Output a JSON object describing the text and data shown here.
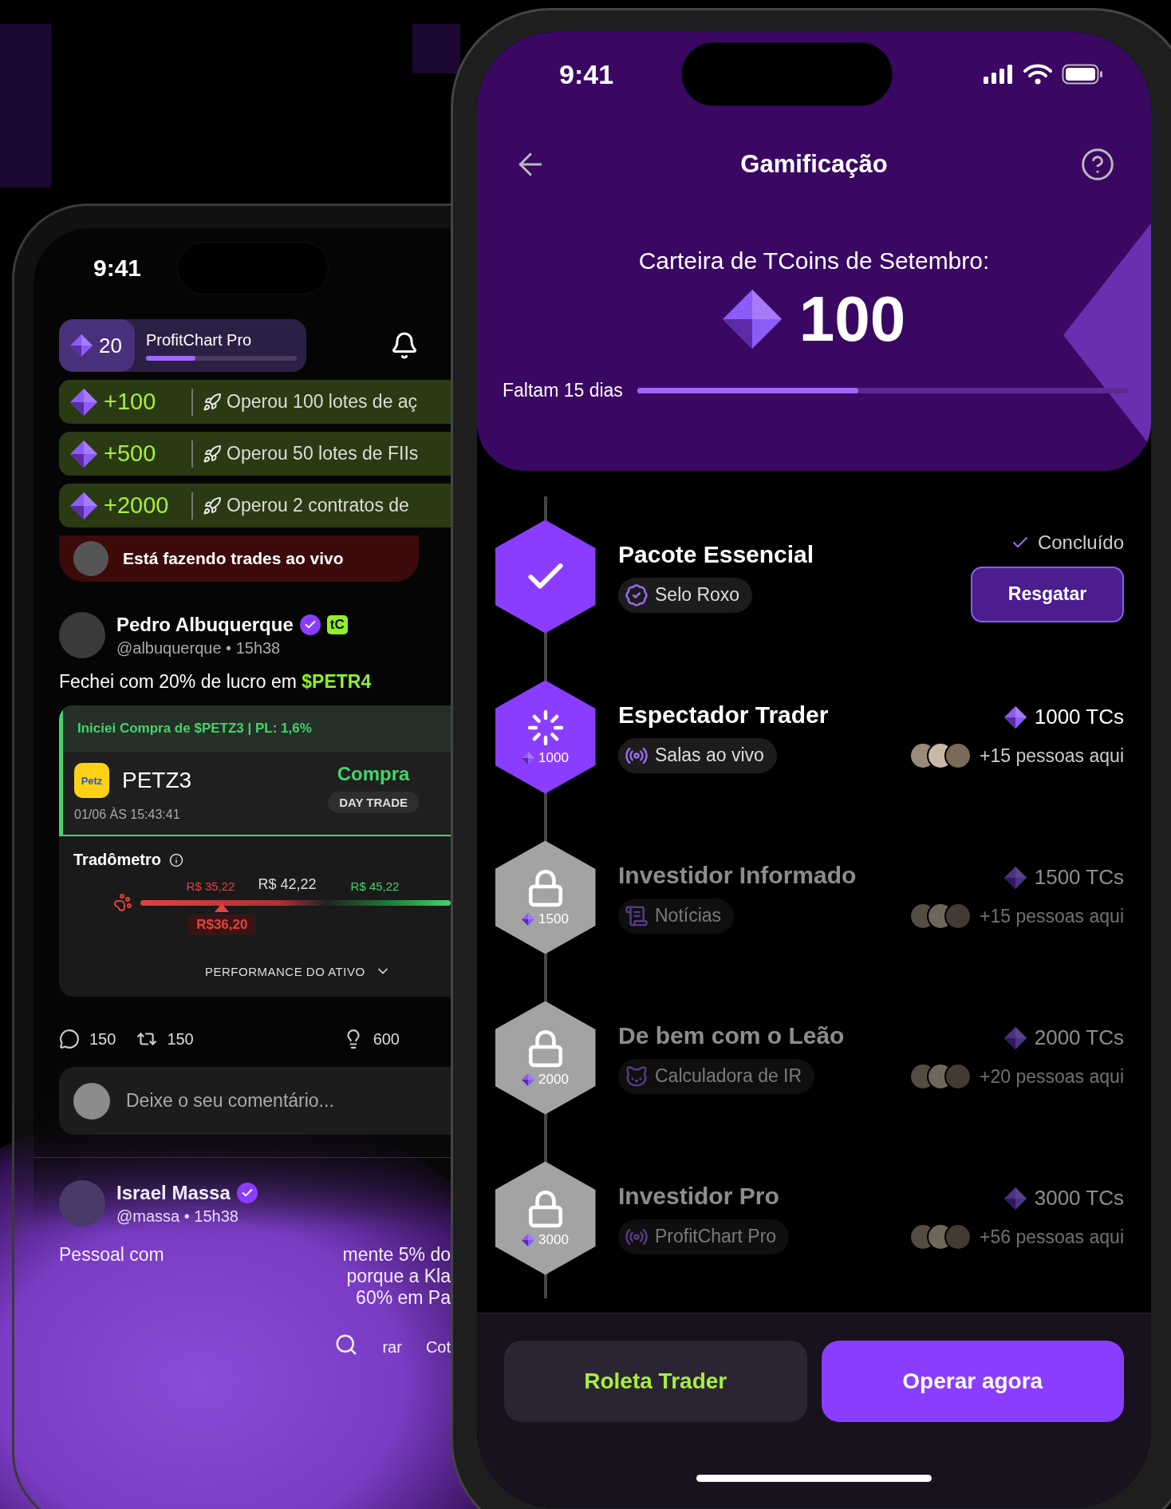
{
  "feed_phone": {
    "status_time": "9:41",
    "wallet": {
      "coins": "20",
      "plan": "ProfitChart Pro",
      "level": 0.33
    },
    "toasts": [
      {
        "amount": "+100",
        "text": "Operou 100 lotes de aç"
      },
      {
        "amount": "+500",
        "text": "Operou 50 lotes de FIIs"
      },
      {
        "amount": "+2000",
        "text": "Operou 2 contratos de"
      }
    ],
    "live_banner": "Está fazendo trades ao vivo",
    "post": {
      "author": "Pedro Albuquerque",
      "verified": true,
      "badge": "tC",
      "handle": "@albuquerque • 15h38",
      "text": "Fechei com 20% de lucro em",
      "ticker": "$PETR4",
      "trade": {
        "headline": "Iniciei Compra de $PETZ3 | PL: 1,6%",
        "logo": "Petz",
        "symbol": "PETZ3",
        "datetime": "01/06 ÀS 15:43:41",
        "side": "Compra",
        "type": "DAY TRADE"
      },
      "meter": {
        "title": "Tradômetro",
        "low": "R$ 35,22",
        "mid": "R$ 42,22",
        "high": "R$ 45,22",
        "current": "R$36,20",
        "level": 0.31,
        "footer": "PERFORMANCE DO ATIVO"
      },
      "comments": "150",
      "reposts": "150",
      "ideas": "600"
    },
    "comment_placeholder": "Deixe o seu comentário...",
    "next_post": {
      "author": "Israel Massa",
      "verified": true,
      "handle": "@massa • 15h38",
      "lines": [
        [
          "Pessoal com",
          "mente 5% do"
        ],
        [
          "porque a Kla"
        ],
        [
          "60% em Pa"
        ]
      ]
    },
    "nav_labels": [
      "rar",
      "Cot"
    ]
  },
  "gamification": {
    "status_time": "9:41",
    "title": "Gamificação",
    "wallet_label": "Carteira de TCoins de Setembro:",
    "balance": "100",
    "days_left": "Faltam 15 dias",
    "month_progress": {
      "level": 0.45
    },
    "milestones": [
      {
        "kind": "done",
        "title": "Pacote Essencial",
        "perk": "Selo Roxo",
        "status": "Concluído",
        "action": "Resgatar"
      },
      {
        "kind": "active",
        "title": "Espectador Trader",
        "perk": "Salas ao vivo",
        "node_value": "1000",
        "cost": "1000 TCs",
        "people": "+15 pessoas aqui"
      },
      {
        "kind": "locked",
        "title": "Investidor Informado",
        "perk": "Notícias",
        "node_value": "1500",
        "cost": "1500 TCs",
        "people": "+15 pessoas aqui"
      },
      {
        "kind": "locked",
        "title": "De bem com o Leão",
        "perk": "Calculadora de IR",
        "node_value": "2000",
        "cost": "2000 TCs",
        "people": "+20 pessoas aqui"
      },
      {
        "kind": "locked",
        "title": "Investidor Pro",
        "perk": "ProfitChart Pro",
        "node_value": "3000",
        "cost": "3000 TCs",
        "people": "+56 pessoas aqui"
      }
    ],
    "buttons": [
      {
        "label": "Roleta Trader",
        "kind": "secondary"
      },
      {
        "label": "Operar agora",
        "kind": "primary"
      }
    ]
  }
}
